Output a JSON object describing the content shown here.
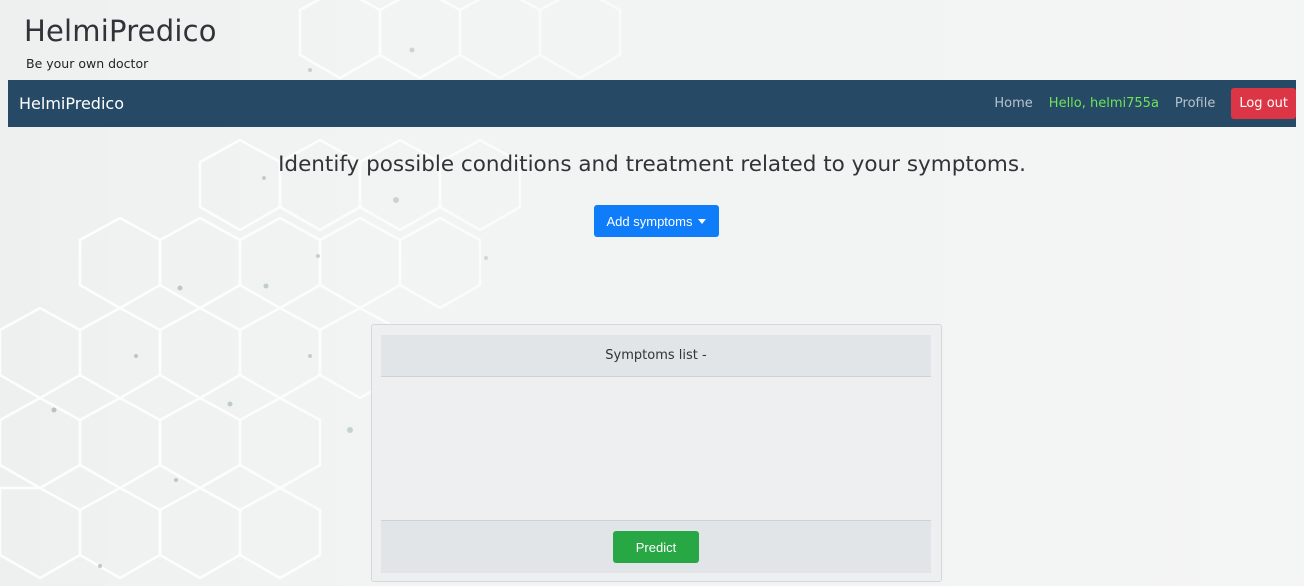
{
  "brand": {
    "title": "HelmiPredico",
    "tagline": "Be your own doctor"
  },
  "navbar": {
    "brand": "HelmiPredico",
    "home_label": "Home",
    "greeting": "Hello, helmi755a",
    "profile_label": "Profile",
    "logout_label": "Log out"
  },
  "main": {
    "headline": "Identify possible conditions and treatment related to your symptoms.",
    "add_symptoms_label": "Add symptoms"
  },
  "symptoms_card": {
    "header": "Symptoms list -",
    "items": [],
    "predict_label": "Predict"
  },
  "colors": {
    "navbar": "#264a66",
    "greeting": "#6fe35a",
    "logout": "#dc3545",
    "primary": "#0f7dfa",
    "success": "#28a745"
  },
  "icons": {
    "dropdown": "caret-down-icon"
  }
}
